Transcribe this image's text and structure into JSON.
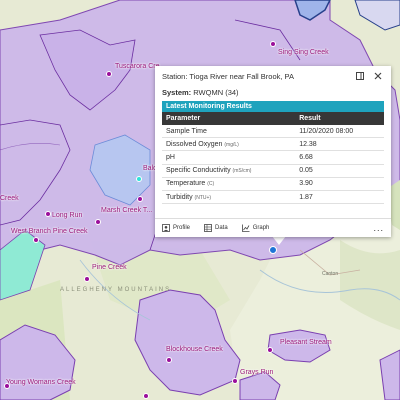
{
  "popup": {
    "title": "Station: Tioga River near Fall Brook, PA",
    "system_label": "System:",
    "system_value": "RWQMN (34)",
    "results_title": "Latest Monitoring Results",
    "columns": [
      "Parameter",
      "Result"
    ],
    "rows": [
      {
        "param": "Sample Time",
        "unit": "",
        "result": "11/20/2020 08:00"
      },
      {
        "param": "Dissolved Oxygen",
        "unit": "(mg/L)",
        "result": "12.38"
      },
      {
        "param": "pH",
        "unit": "",
        "result": "6.68"
      },
      {
        "param": "Specific Conductivity",
        "unit": "(mS/cm)",
        "result": "0.05"
      },
      {
        "param": "Temperature",
        "unit": "(C)",
        "result": "3.90"
      },
      {
        "param": "Turbidity",
        "unit": "(NTU+)",
        "result": "1.87"
      }
    ],
    "footer": {
      "profile": "Profile",
      "data": "Data",
      "graph": "Graph",
      "more": "..."
    },
    "icons": {
      "dock": "dock-icon",
      "close": "close-icon"
    }
  },
  "map": {
    "labels": {
      "tuscarora": "Tuscarora Cre...",
      "sing_sing": "Sing Sing Creek",
      "bald": "Bald",
      "long_run": "Long Run",
      "marsh_creek": "Marsh Creek T...",
      "creek_left": "Creek",
      "west_branch": "West Branch Pine Creek",
      "pine_creek": "Pine Creek",
      "blockhouse": "Blockhouse Creek",
      "pleasant_stream": "Pleasant Stream",
      "grays_run": "Grays Run",
      "young_womans": "Young Womans Creek"
    },
    "region_label": "ALLEGHENY MOUNTAINS",
    "towns": {
      "canton": "Canton"
    },
    "colors": {
      "watershed_fill": "#cdb8ea",
      "watershed_stroke": "#7a3fb0",
      "station_dot": "#9b0f9b",
      "selected_dot": "#1e74d6",
      "header_teal": "#1fa3bd",
      "table_header": "#373737"
    }
  }
}
